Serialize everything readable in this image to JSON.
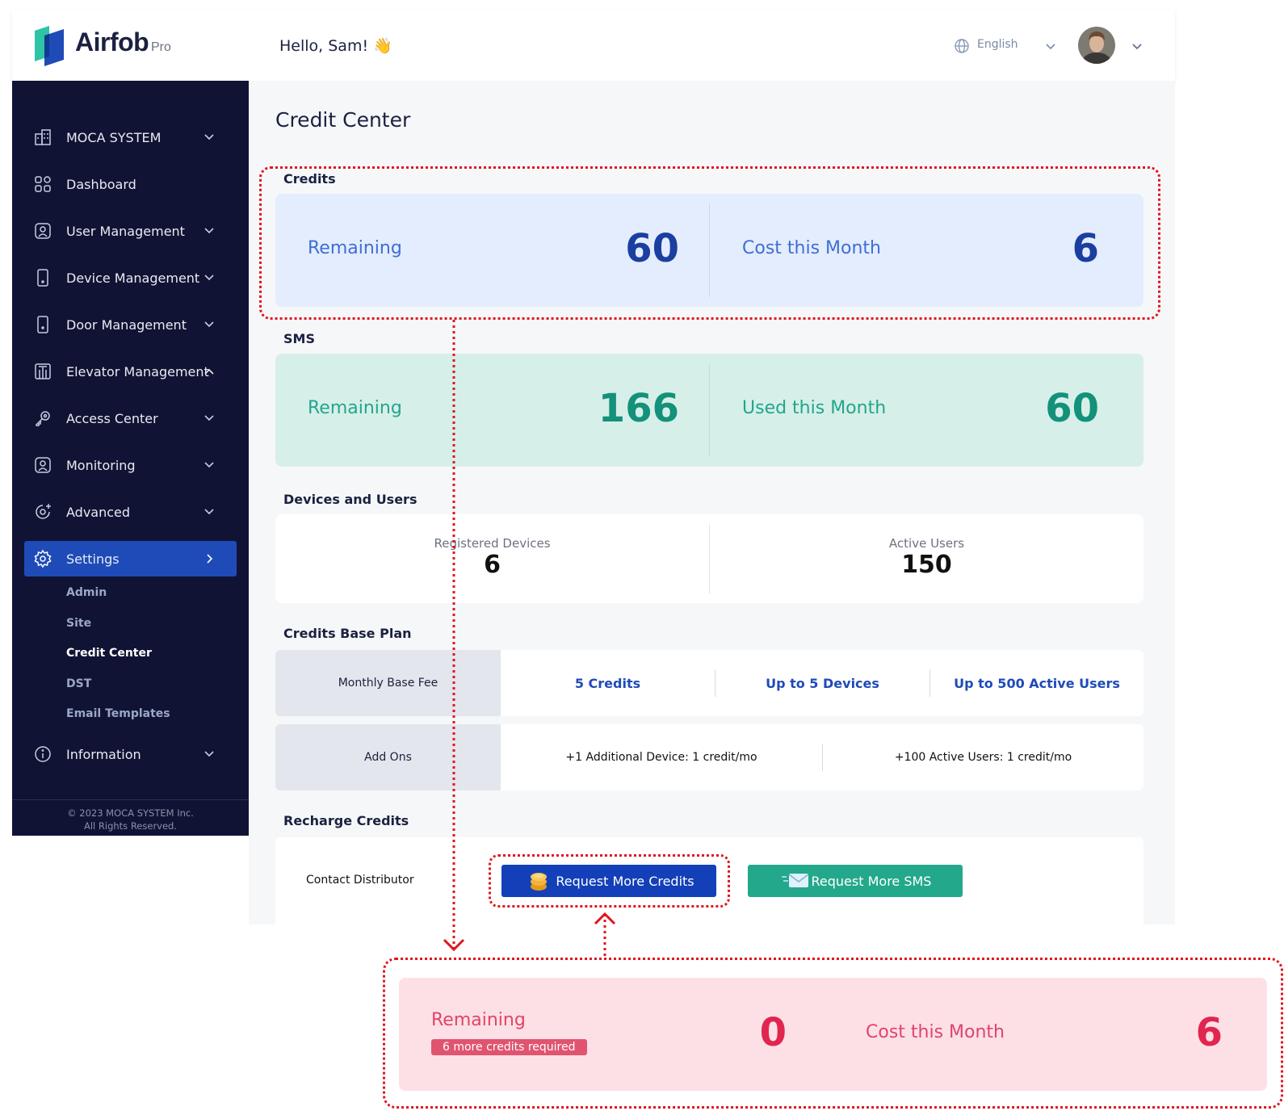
{
  "header": {
    "brand": "Airfob",
    "brand_suffix": "Pro",
    "greeting": "Hello, Sam! 👋",
    "language": "English"
  },
  "sidebar": {
    "items": [
      {
        "label": "MOCA SYSTEM",
        "icon": "building-icon",
        "expanded": false
      },
      {
        "label": "Dashboard",
        "icon": "dashboard-grid-icon"
      },
      {
        "label": "User Management",
        "icon": "user-card-icon",
        "expanded": false
      },
      {
        "label": "Device Management",
        "icon": "device-icon",
        "expanded": false
      },
      {
        "label": "Door Management",
        "icon": "door-icon",
        "expanded": false
      },
      {
        "label": "Elevator Management",
        "icon": "elevator-icon",
        "expanded": true
      },
      {
        "label": "Access Center",
        "icon": "key-icon",
        "expanded": false
      },
      {
        "label": "Monitoring",
        "icon": "monitor-user-icon",
        "expanded": false
      },
      {
        "label": "Advanced",
        "icon": "advanced-icon",
        "expanded": false
      },
      {
        "label": "Settings",
        "icon": "gear-icon",
        "active": true
      },
      {
        "label": "Information",
        "icon": "info-icon",
        "expanded": false
      }
    ],
    "settings_sub": [
      "Admin",
      "Site",
      "Credit Center",
      "DST",
      "Email Templates"
    ],
    "active_sub": "Credit Center",
    "footer": "© 2023 MOCA SYSTEM Inc. All Rights Reserved."
  },
  "main": {
    "page_title": "Credit Center",
    "credits": {
      "title": "Credits",
      "remaining_label": "Remaining",
      "remaining_value": "60",
      "cost_label": "Cost this Month",
      "cost_value": "6"
    },
    "sms": {
      "title": "SMS",
      "remaining_label": "Remaining",
      "remaining_value": "166",
      "used_label": "Used this Month",
      "used_value": "60"
    },
    "devices_users": {
      "title": "Devices and Users",
      "registered_label": "Registered Devices",
      "registered_value": "6",
      "active_label": "Active Users",
      "active_value": "150"
    },
    "base_plan": {
      "title": "Credits Base Plan",
      "fee_label": "Monthly Base Fee",
      "fee_items": [
        "5 Credits",
        "Up to 5 Devices",
        "Up to 500 Active Users"
      ],
      "addons_label": "Add Ons",
      "addon_items": [
        "+1 Additional Device: 1 credit/mo",
        "+100 Active Users: 1 credit/mo"
      ]
    },
    "recharge": {
      "title": "Recharge Credits",
      "contact_label": "Contact Distributor",
      "request_credits": "Request More Credits",
      "request_sms": "Request More SMS"
    }
  },
  "callout": {
    "remaining_label": "Remaining",
    "badge": "6 more credits required",
    "remaining_value": "0",
    "cost_label": "Cost this Month",
    "cost_value": "6"
  },
  "colors": {
    "sidebar_bg": "#111334",
    "accent_blue": "#1f4bb8",
    "credit_blue": "#1b3fa0",
    "sms_green": "#13917a",
    "alert_red": "#e0264f",
    "annotation_red": "#e0161e"
  }
}
